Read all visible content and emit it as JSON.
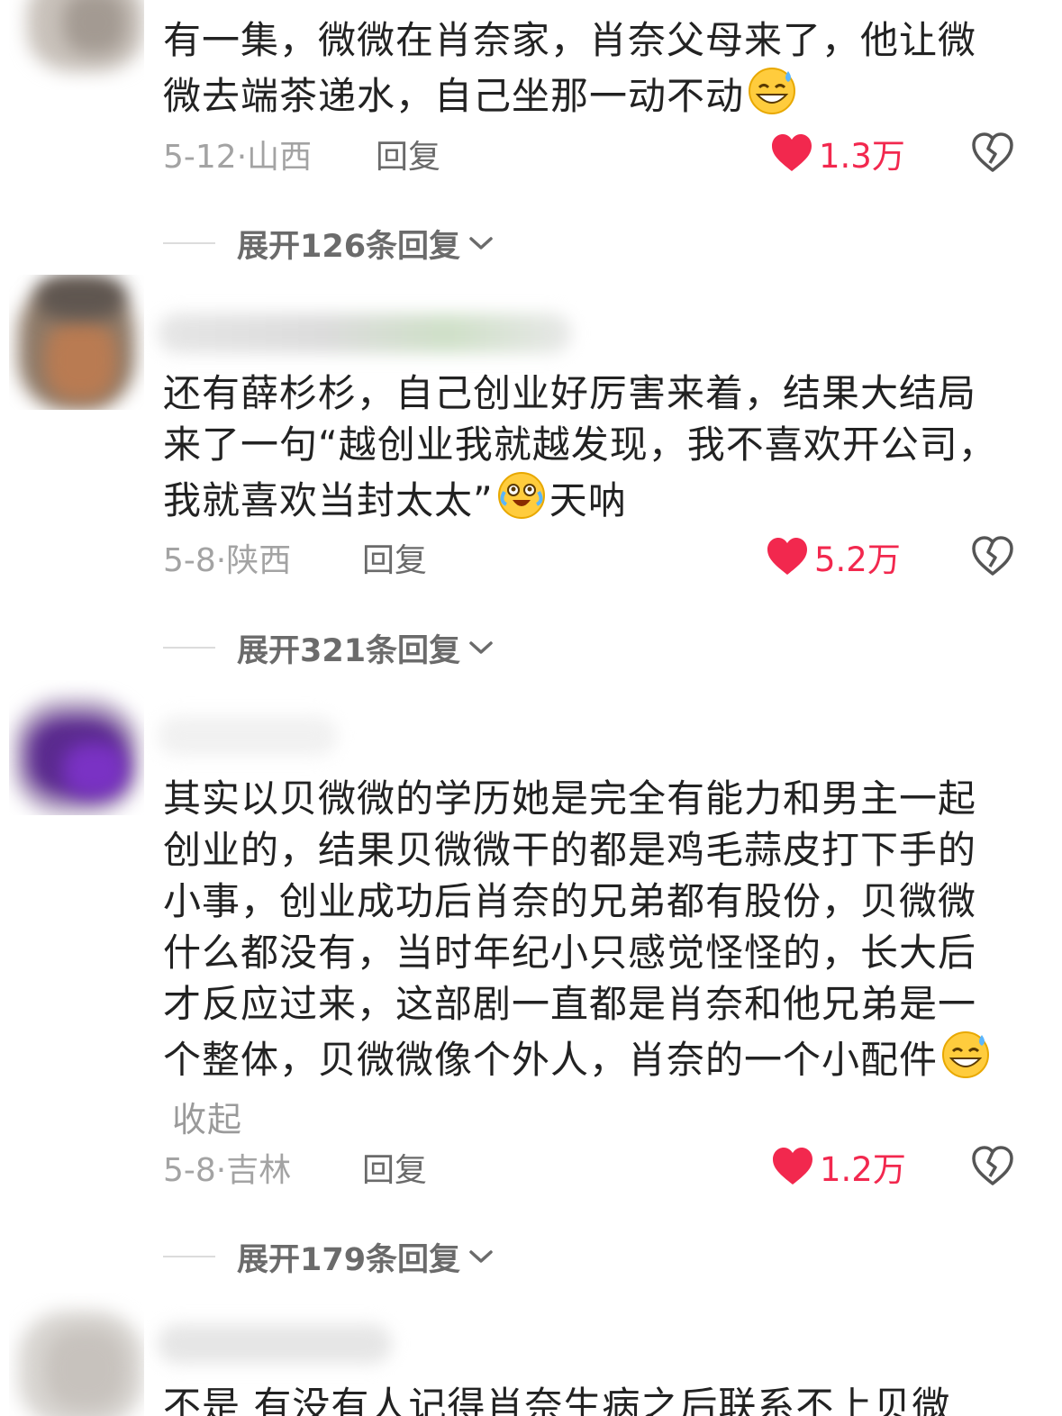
{
  "comments": [
    {
      "text": "有一集，微微在肖奈家，肖奈父母来了，他让微微去端茶递水，自己坐那一动不动",
      "emoji": "sweat-smile-emoji",
      "date": "5-12·山西",
      "reply_label": "回复",
      "likes": "1.3万",
      "expand_label": "展开126条回复"
    },
    {
      "text_before": "还有薛杉杉，自己创业好厉害来着，结果大结局来了一句“越创业我就越发现，我不喜欢开公司，我就喜欢当封太太”",
      "emoji": "tears-of-joy-emoji",
      "text_after": "天呐",
      "date": "5-8·陕西",
      "reply_label": "回复",
      "likes": "5.2万",
      "expand_label": "展开321条回复"
    },
    {
      "text": "其实以贝微微的学历她是完全有能力和男主一起创业的，结果贝微微干的都是鸡毛蒜皮打下手的小事，创业成功后肖奈的兄弟都有股份，贝微微什么都没有，当时年纪小只感觉怪怪的，长大后才反应过来，这部剧一直都是肖奈和他兄弟是一个整体，贝微微像个外人，肖奈的一个小配件",
      "emoji": "sweat-smile-emoji",
      "collapse_label": "收起",
      "date": "5-8·吉林",
      "reply_label": "回复",
      "likes": "1.2万",
      "expand_label": "展开179条回复"
    },
    {
      "text": "不是 有没有人记得肖奈生病之后联系不上贝微"
    }
  ],
  "colors": {
    "like_red": "#f2284e",
    "meta_grey": "#a3a3a3",
    "text": "#222222"
  }
}
